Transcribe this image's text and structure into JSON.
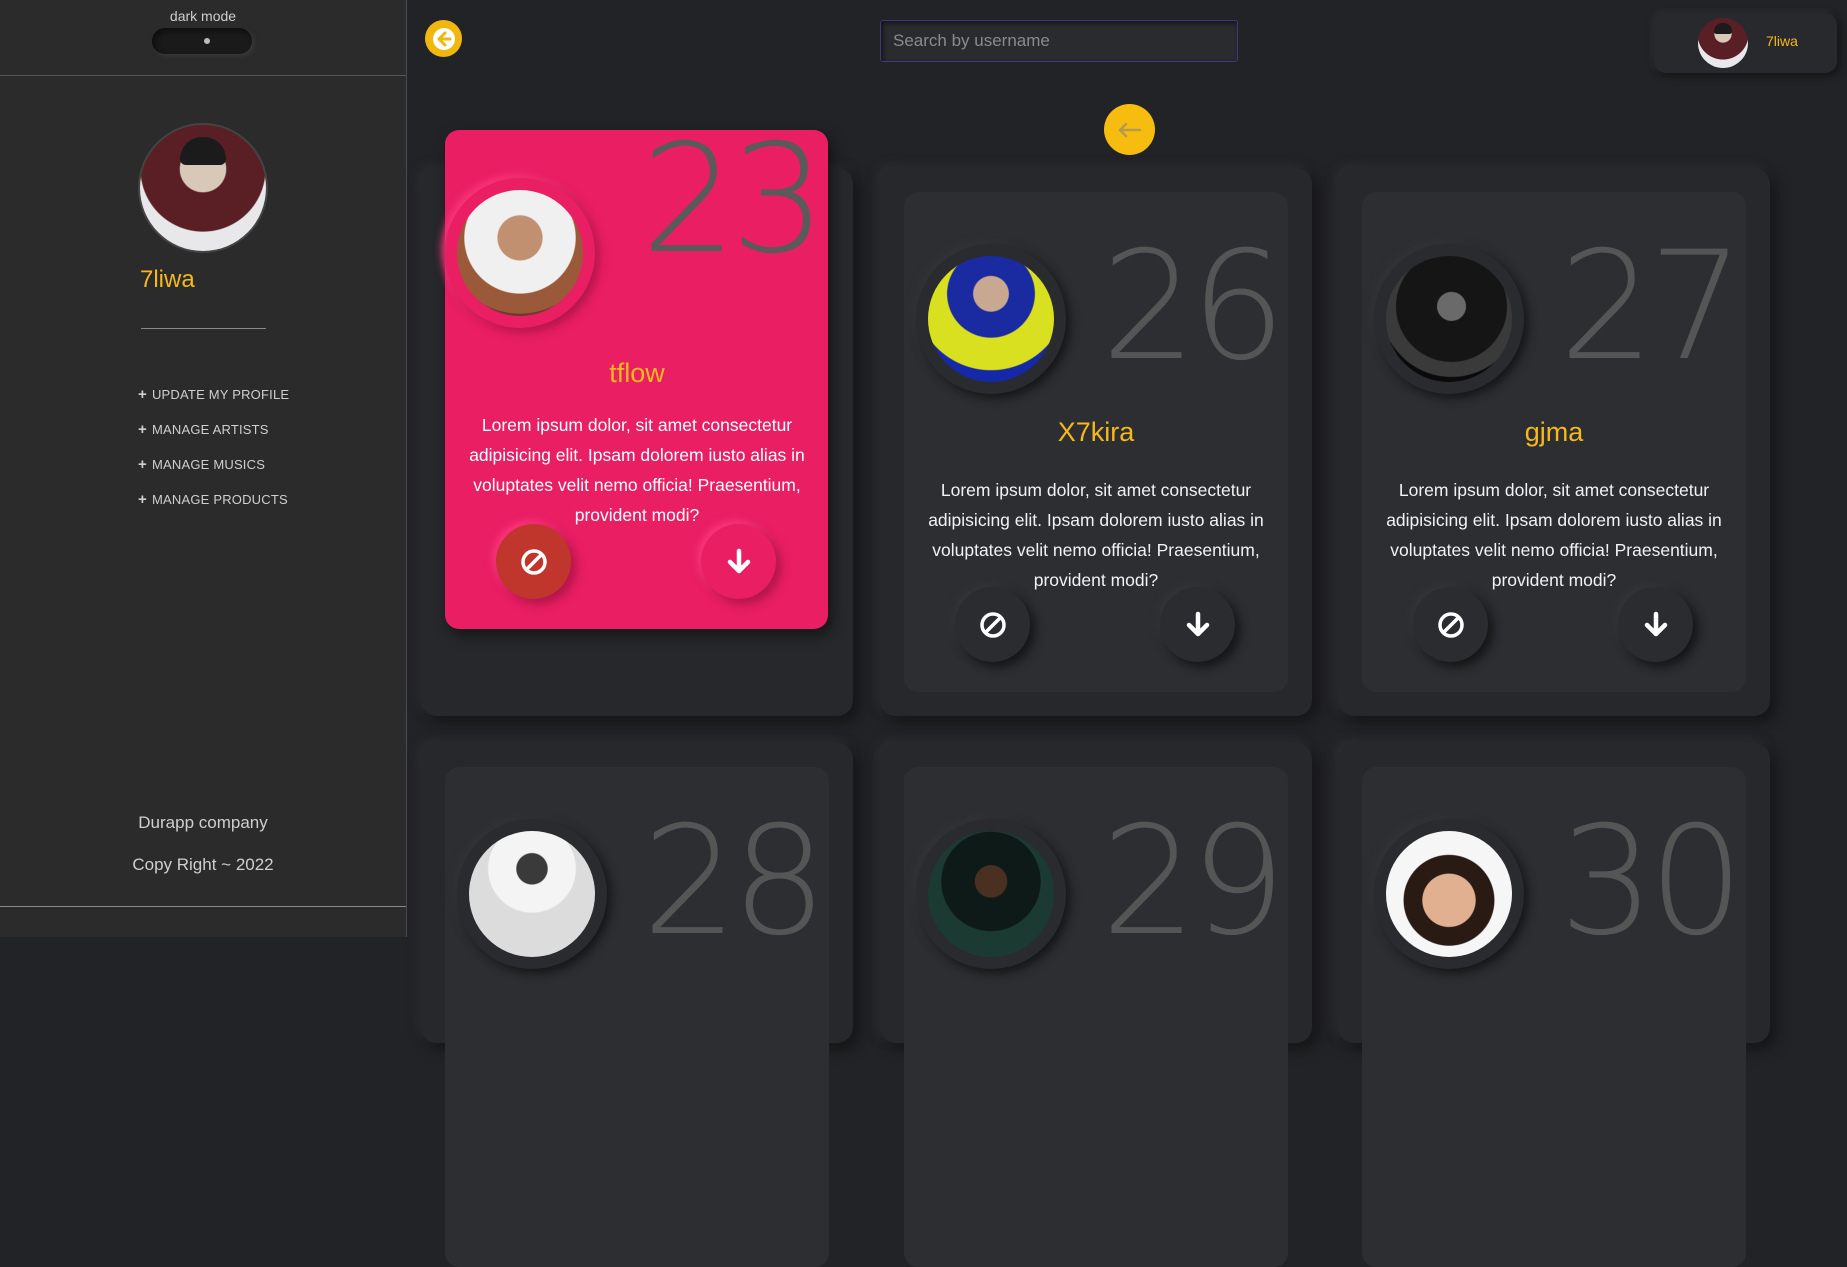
{
  "sidebar": {
    "dark_mode_label": "dark mode",
    "profile_name": "7liwa",
    "menu": [
      {
        "label": "UPDATE MY PROFILE"
      },
      {
        "label": "MANAGE ARTISTS"
      },
      {
        "label": "MANAGE MUSICS"
      },
      {
        "label": "MANAGE PRODUCTS"
      }
    ],
    "company": "Durapp company",
    "copyright": "Copy Right ~ 2022"
  },
  "header": {
    "search_placeholder": "Search by username",
    "user_name": "7liwa"
  },
  "artists": [
    {
      "number": "23",
      "name": "tflow",
      "description": "Lorem ipsum dolor, sit amet consectetur adipisicing elit. Ipsam dolorem iusto alias in voluptates velit nemo officia! Praesentium, provident modi?",
      "highlighted": true
    },
    {
      "number": "26",
      "name": "X7kira",
      "description": "Lorem ipsum dolor, sit amet consectetur adipisicing elit. Ipsam dolorem iusto alias in voluptates velit nemo officia! Praesentium, provident modi?"
    },
    {
      "number": "27",
      "name": "gjma",
      "description": "Lorem ipsum dolor, sit amet consectetur adipisicing elit. Ipsam dolorem iusto alias in voluptates velit nemo officia! Praesentium, provident modi?"
    },
    {
      "number": "28",
      "name": "",
      "description": ""
    },
    {
      "number": "29",
      "name": "",
      "description": ""
    },
    {
      "number": "30",
      "name": "",
      "description": ""
    }
  ],
  "colors": {
    "accent": "#f6b81a",
    "highlight": "#e91e63",
    "background": "#222326"
  },
  "icons": {
    "back": "arrow-left-circle-icon",
    "block": "ban-icon",
    "download": "arrow-down-icon",
    "prev": "arrow-left-icon",
    "add": "plus-icon"
  }
}
